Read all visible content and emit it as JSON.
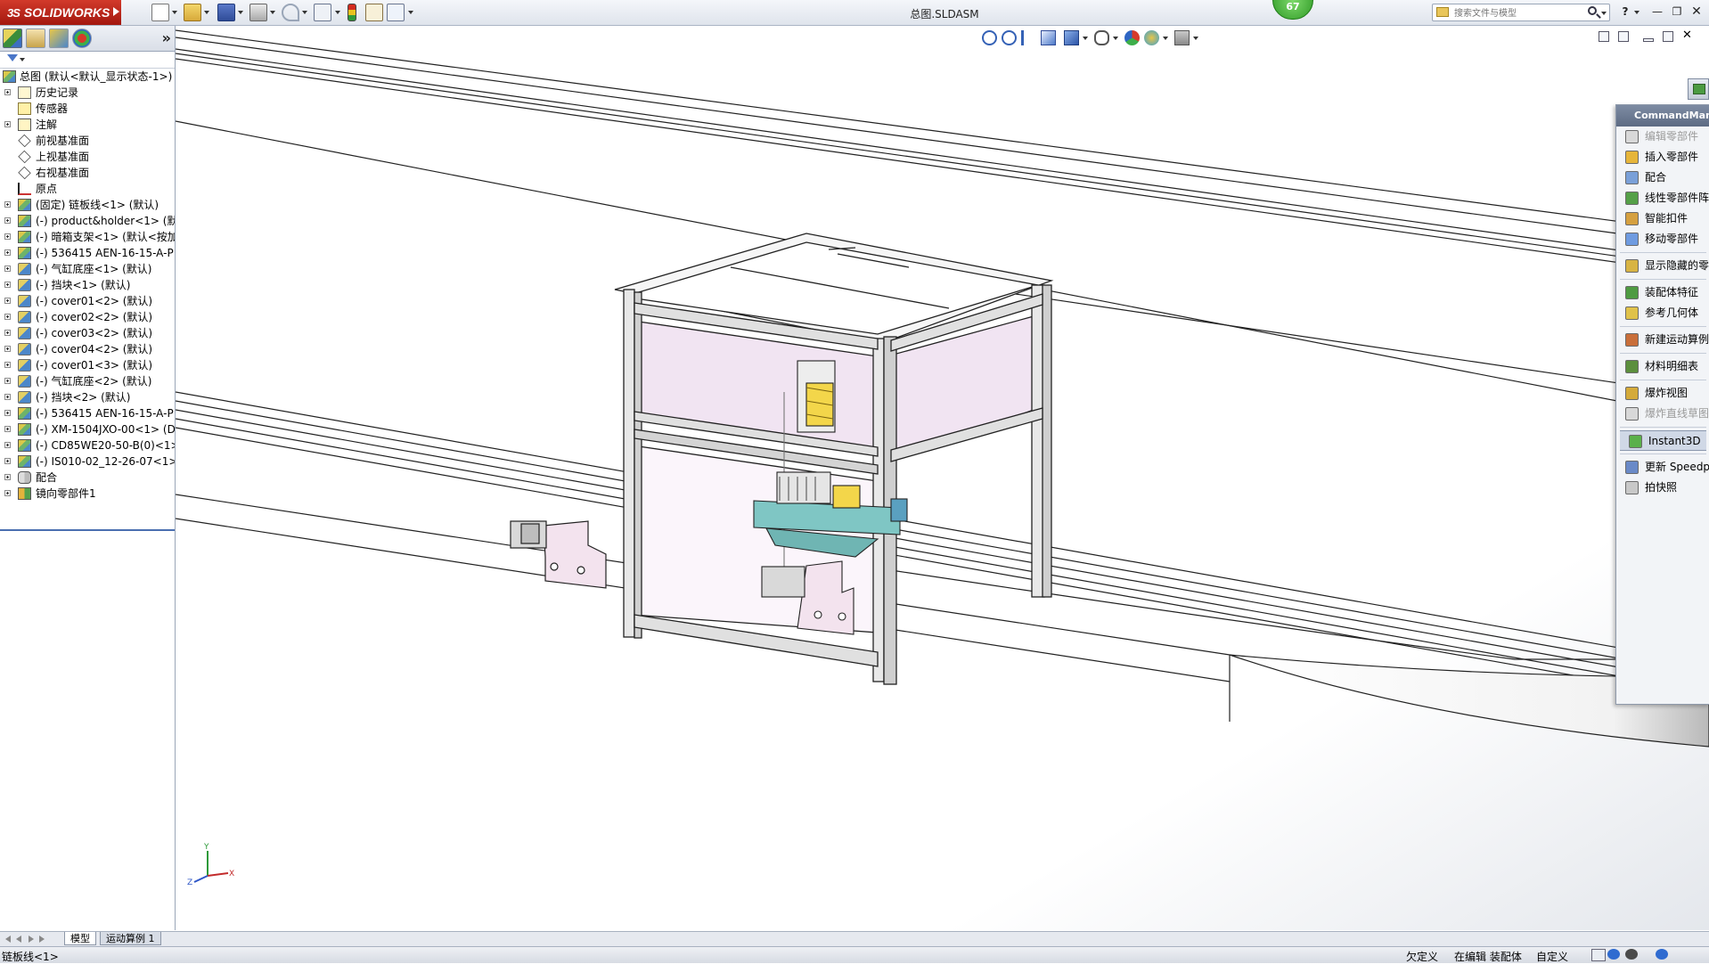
{
  "app": {
    "brand": "SOLIDWORKS",
    "brand_prefix": "3S",
    "document_title": "总图.SLDASM",
    "badge_count": "67",
    "search_placeholder": "搜索文件与模型"
  },
  "feature_tree": {
    "root": "总图 (默认<默认_显示状态-1>)",
    "items": [
      {
        "label": "历史记录",
        "icon": "history-icon"
      },
      {
        "label": "传感器",
        "icon": "sensor-icon"
      },
      {
        "label": "注解",
        "icon": "annotation-icon"
      },
      {
        "label": "前视基准面",
        "icon": "plane-icon"
      },
      {
        "label": "上视基准面",
        "icon": "plane-icon"
      },
      {
        "label": "右视基准面",
        "icon": "plane-icon"
      },
      {
        "label": "原点",
        "icon": "origin-icon"
      },
      {
        "label": "(固定) 链板线<1> (默认)",
        "icon": "assembly-icon"
      },
      {
        "label": "(-) product&holder<1> (默",
        "icon": "assembly-icon"
      },
      {
        "label": "(-) 暗箱支架<1> (默认<按加",
        "icon": "assembly-icon"
      },
      {
        "label": "(-) 536415 AEN-16-15-A-P",
        "icon": "assembly-icon"
      },
      {
        "label": "(-) 气缸底座<1> (默认)",
        "icon": "part-icon"
      },
      {
        "label": "(-) 挡块<1> (默认)",
        "icon": "part-icon"
      },
      {
        "label": "(-) cover01<2> (默认)",
        "icon": "part-icon"
      },
      {
        "label": "(-) cover02<2> (默认)",
        "icon": "part-icon"
      },
      {
        "label": "(-) cover03<2> (默认)",
        "icon": "part-icon"
      },
      {
        "label": "(-) cover04<2> (默认)",
        "icon": "part-icon"
      },
      {
        "label": "(-) cover01<3> (默认)",
        "icon": "part-icon"
      },
      {
        "label": "(-) 气缸底座<2> (默认)",
        "icon": "part-icon"
      },
      {
        "label": "(-) 挡块<2> (默认)",
        "icon": "part-icon"
      },
      {
        "label": "(-) 536415 AEN-16-15-A-P",
        "icon": "assembly-icon"
      },
      {
        "label": "(-) XM-1504JXO-00<1> (D",
        "icon": "assembly-icon"
      },
      {
        "label": "(-) CD85WE20-50-B(0)<1>",
        "icon": "assembly-icon"
      },
      {
        "label": "(-) IS010-02_12-26-07<1>",
        "icon": "assembly-icon"
      },
      {
        "label": "配合",
        "icon": "mates-icon"
      },
      {
        "label": "镜向零部件1",
        "icon": "mirror-icon"
      }
    ]
  },
  "command_manager": {
    "title": "CommandManager",
    "groups": [
      [
        {
          "label": "编辑零部件",
          "disabled": true
        },
        {
          "label": "插入零部件"
        },
        {
          "label": "配合"
        },
        {
          "label": "线性零部件阵列"
        },
        {
          "label": "智能扣件"
        },
        {
          "label": "移动零部件"
        }
      ],
      [
        {
          "label": "显示隐藏的零部件"
        }
      ],
      [
        {
          "label": "装配体特征"
        },
        {
          "label": "参考几何体"
        }
      ],
      [
        {
          "label": "新建运动算例"
        }
      ],
      [
        {
          "label": "材料明细表"
        }
      ],
      [
        {
          "label": "爆炸视图"
        },
        {
          "label": "爆炸直线草图",
          "disabled": true
        }
      ],
      [
        {
          "label": "Instant3D",
          "pressed": true
        }
      ],
      [
        {
          "label": "更新 Speedpak"
        },
        {
          "label": "拍快照"
        }
      ]
    ]
  },
  "bottom_tabs": [
    "模型",
    "运动算例 1"
  ],
  "status": {
    "left": "链板线<1>",
    "definition": "欠定义",
    "editing": "在编辑 装配体",
    "units": "自定义"
  },
  "triad": {
    "x": "X",
    "y": "Y",
    "z": "Z"
  },
  "colors": {
    "brand_red": "#c0281c",
    "glass_pink": "#f1e4f2",
    "actuator_teal": "#7fc6c4",
    "sensor_yellow": "#f3d64a"
  }
}
